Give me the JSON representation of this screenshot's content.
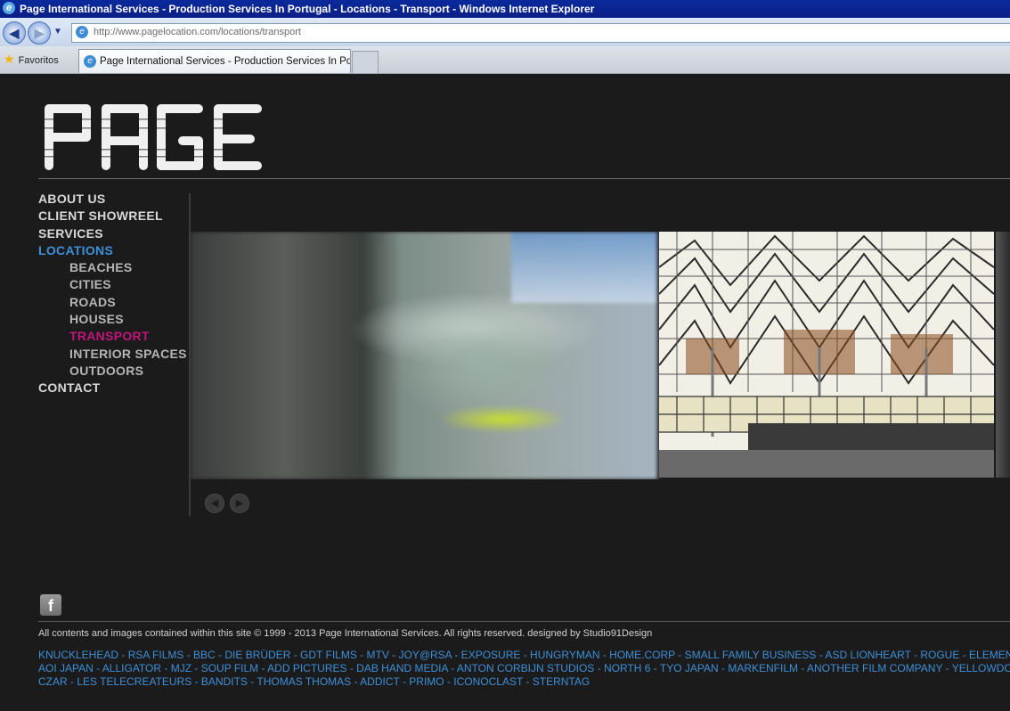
{
  "browser": {
    "window_title": "Page International Services - Production Services In Portugal - Locations - Transport - Windows Internet Explorer",
    "address": "http://www.pagelocation.com/locations/transport",
    "favorites_label": "Favoritos",
    "tab_title": "Page International Services - Production Services In Po..."
  },
  "site": {
    "logo_text": "PAGE"
  },
  "nav": {
    "items": [
      {
        "label": "ABOUT US"
      },
      {
        "label": "CLIENT SHOWREEL"
      },
      {
        "label": "SERVICES"
      },
      {
        "label": "LOCATIONS"
      },
      {
        "label": "BEACHES"
      },
      {
        "label": "CITIES"
      },
      {
        "label": "ROADS"
      },
      {
        "label": "HOUSES"
      },
      {
        "label": "TRANSPORT"
      },
      {
        "label": "INTERIOR SPACES"
      },
      {
        "label": "OUTDOORS"
      },
      {
        "label": "CONTACT"
      }
    ]
  },
  "colors": {
    "background": "#1b1b1b",
    "nav_active": "#3e8fd8",
    "nav_current": "#c0157a",
    "link": "#3e8fd8"
  },
  "footer": {
    "copyright": "All contents and images contained within this site © 1999 - 2013 Page International Services. All rights reserved. designed by Studio91Design",
    "clients_lines": [
      "KNUCKLEHEAD - RSA FILMS - BBC - DIE BRÜDER - GDT FILMS - MTV - JOY@RSA - EXPOSURE - HUNGRYMAN - HOME.CORP - SMALL FAMILY BUSINESS - ASD LIONHEART - ROGUE - ELEMENT",
      "AOI JAPAN - ALLIGATOR - MJZ - SOUP FILM - ADD PICTURES - DAB HAND MEDIA - ANTON CORBIJN STUDIOS - NORTH 6 - TYO JAPAN - MARKENFILM - ANOTHER FILM COMPANY - YELLOWDOG",
      "CZAR - LES TELECREATEURS - BANDITS - THOMAS THOMAS - ADDICT - PRIMO - ICONOCLAST - STERNTAG"
    ]
  }
}
